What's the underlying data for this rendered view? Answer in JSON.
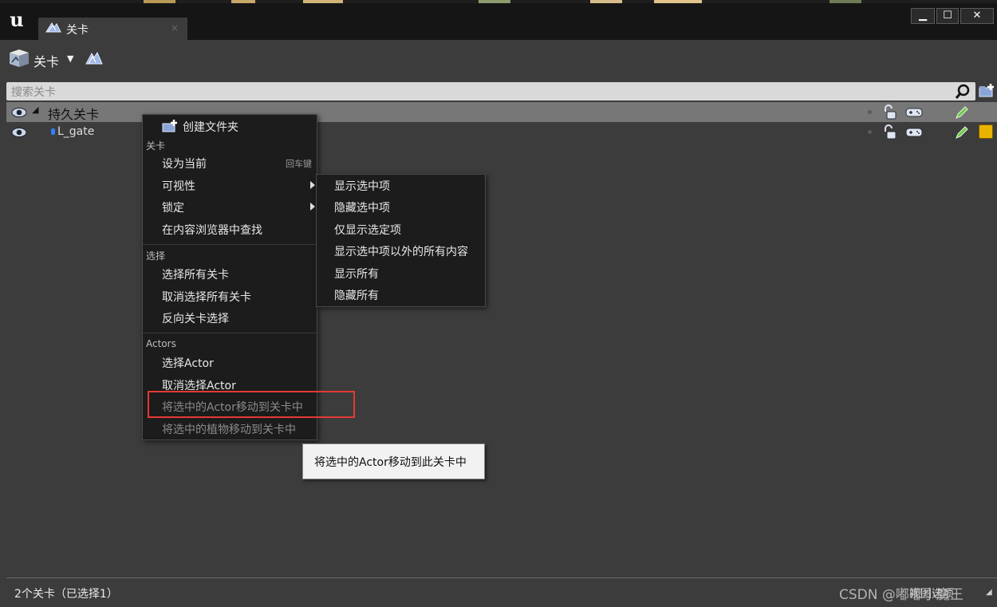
{
  "tab": {
    "label": "关卡",
    "close_glyph": "×"
  },
  "window_controls": {
    "minimize": "▁",
    "maximize": "☐",
    "close": "✕"
  },
  "toolbar": {
    "levels_label": "关卡"
  },
  "search": {
    "placeholder": "搜索关卡",
    "value": ""
  },
  "levels": [
    {
      "name": "持久关卡",
      "selected": true,
      "expanded": true
    },
    {
      "name": "L_gate",
      "selected": false,
      "color": "#e8b400"
    }
  ],
  "context_menu": {
    "create_folder": "创建文件夹",
    "section_levels": "关卡",
    "set_current": "设为当前",
    "set_current_shortcut": "回车键",
    "visibility": "可视性",
    "lock": "锁定",
    "find_in_content_browser": "在内容浏览器中查找",
    "section_select": "选择",
    "select_all_levels": "选择所有关卡",
    "deselect_all_levels": "取消选择所有关卡",
    "invert_level_selection": "反向关卡选择",
    "section_actors": "Actors",
    "select_actors": "选择Actor",
    "deselect_actors": "取消选择Actor",
    "move_actors_to_level": "将选中的Actor移动到关卡中",
    "move_foliage_to_level": "将选中的植物移动到关卡中"
  },
  "visibility_submenu": [
    "显示选中项",
    "隐藏选中项",
    "仅显示选定项",
    "显示选中项以外的所有内容",
    "显示所有",
    "隐藏所有"
  ],
  "tooltip": {
    "text": "将选中的Actor移动到此关卡中"
  },
  "status_bar": {
    "summary": "2个关卡（已选择1）",
    "view_options": "视图选项"
  },
  "watermark": "CSDN @嘟嘟小魔王",
  "colors": {
    "accent_highlight": "#e53935",
    "level_color": "#e8b400",
    "selected_row": "#777777"
  }
}
